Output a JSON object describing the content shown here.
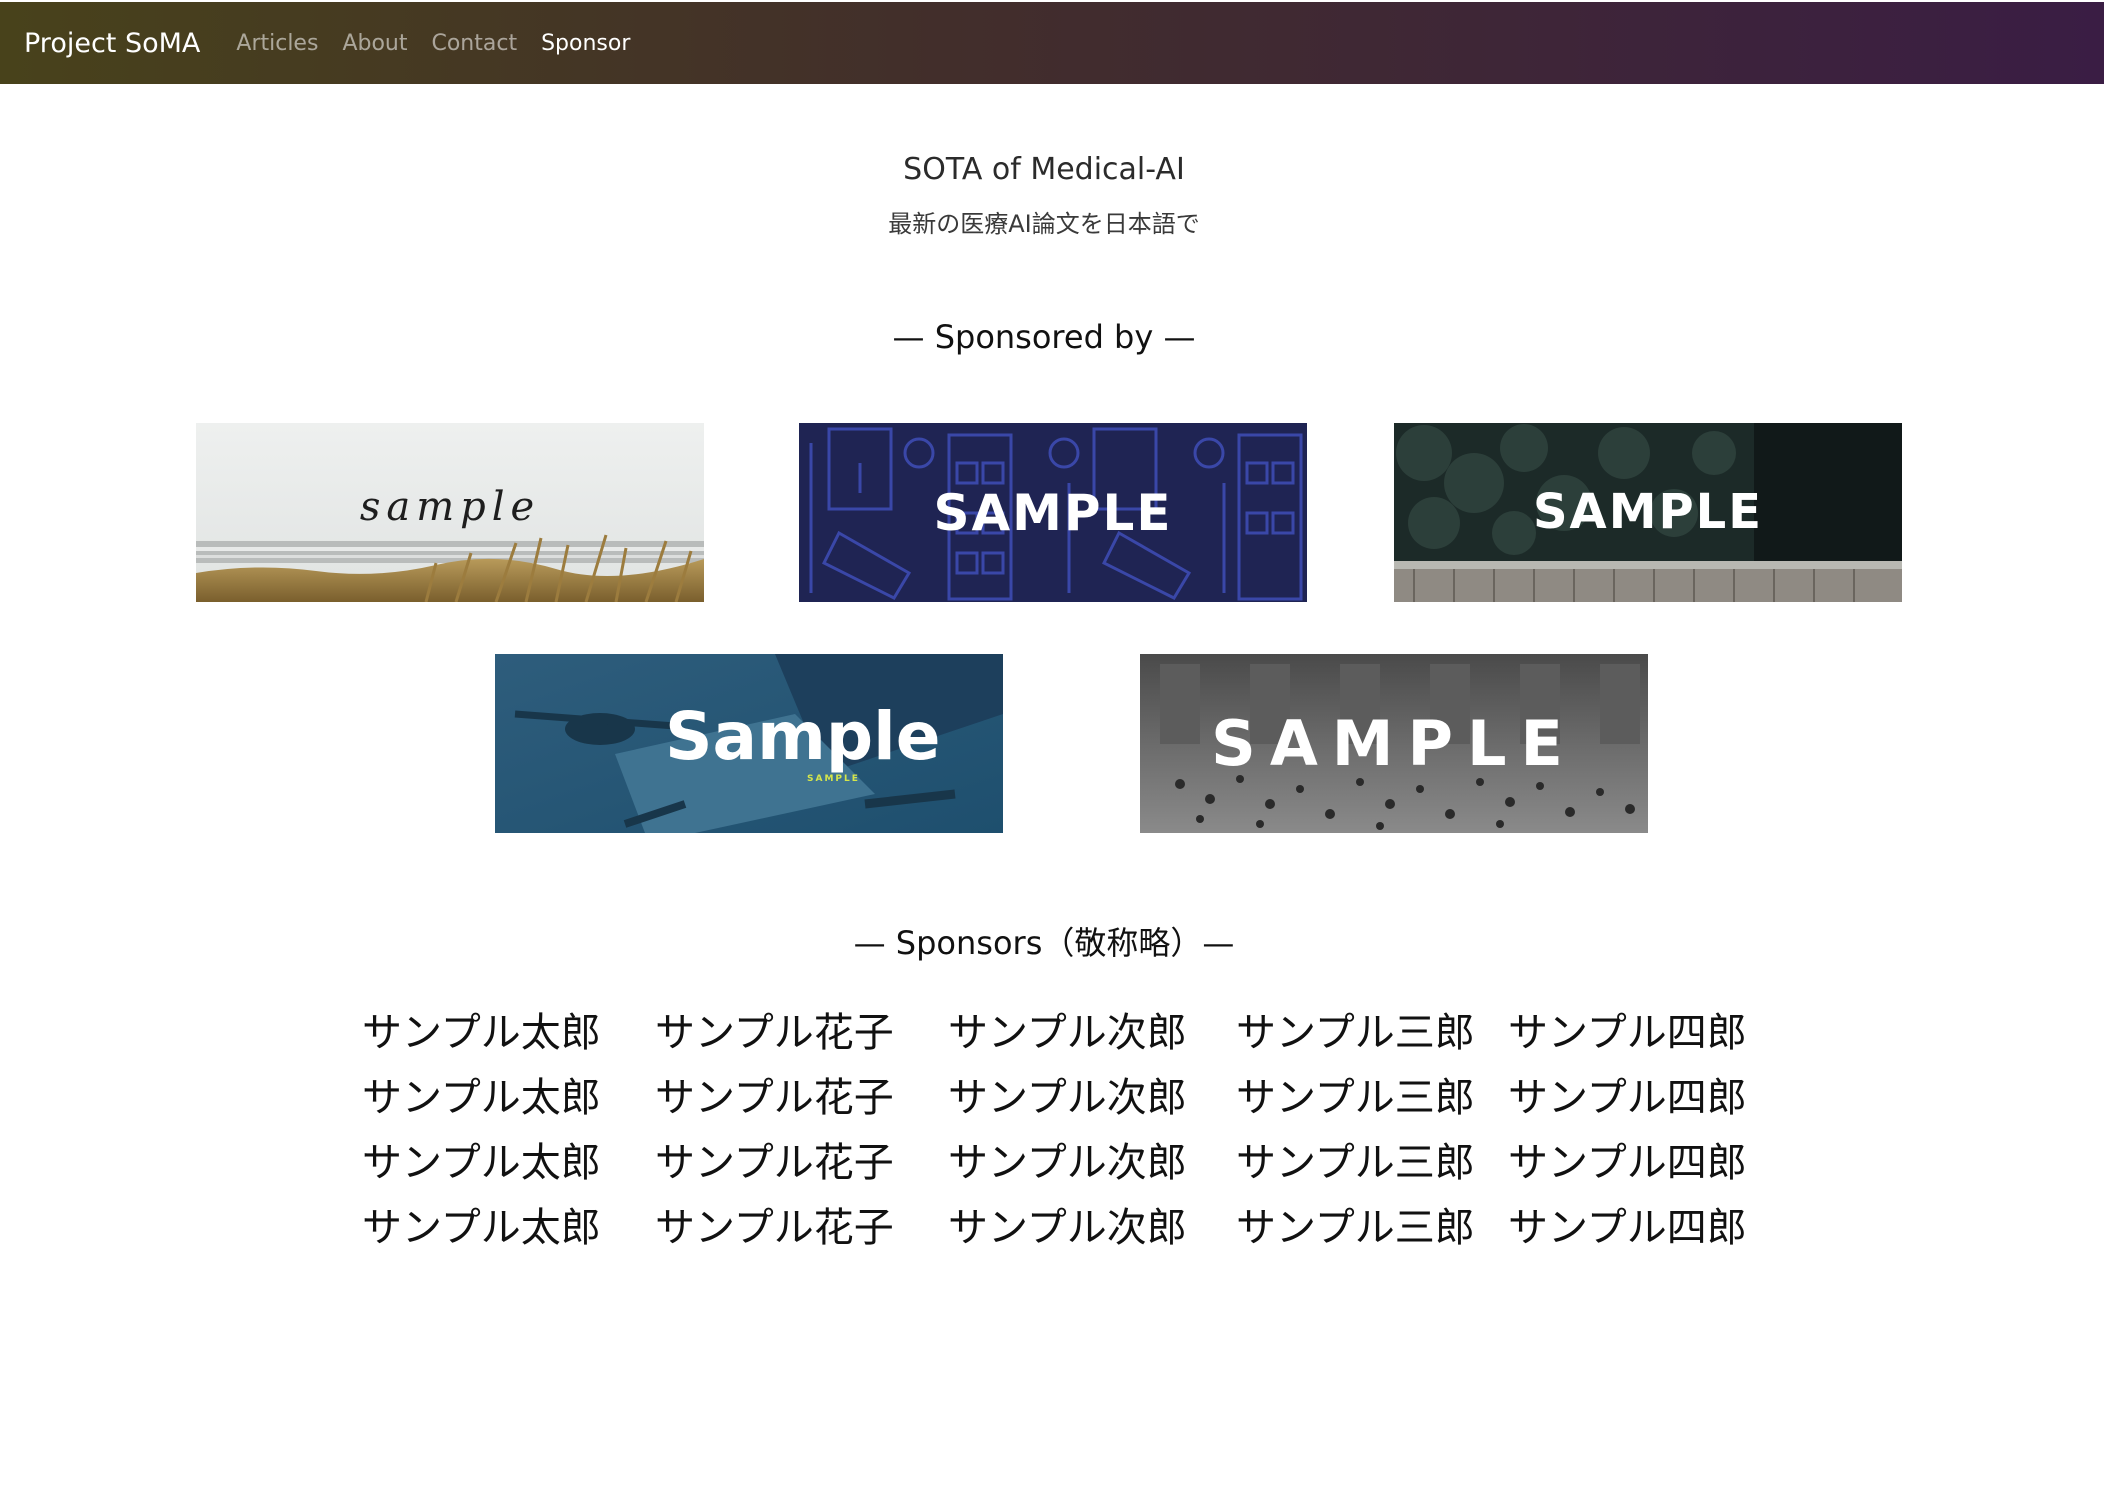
{
  "nav": {
    "brand": "Project SoMA",
    "links": [
      "Articles",
      "About",
      "Contact",
      "Sponsor"
    ],
    "active": "Sponsor"
  },
  "hero": {
    "title": "SOTA of Medical-AI",
    "subtitle": "最新の医療AI論文を日本語で"
  },
  "sponsored_by_heading": "— Sponsored by —",
  "banners": [
    {
      "label": "sample",
      "theme": "beach-grass"
    },
    {
      "label": "SAMPLE",
      "theme": "navy-line-icons"
    },
    {
      "label": "SAMPLE",
      "theme": "dark-forest-boardwalk"
    },
    {
      "label": "Sample",
      "sublabel": "SAMPLE",
      "theme": "blue-desk"
    },
    {
      "label": "SAMPLE",
      "theme": "grayscale-station-crowd"
    }
  ],
  "colors": {
    "navbar_start": "#48421b",
    "navbar_end": "#3a1d44",
    "banner2_bg": "#1f2453",
    "banner4_accent": "#d6e64a"
  },
  "sponsors_heading": "— Sponsors（敬称略）—",
  "sponsor_rows": [
    [
      "サンプル太郎",
      "サンプル花子",
      "サンプル次郎",
      "サンプル三郎",
      "サンプル四郎"
    ],
    [
      "サンプル太郎",
      "サンプル花子",
      "サンプル次郎",
      "サンプル三郎",
      "サンプル四郎"
    ],
    [
      "サンプル太郎",
      "サンプル花子",
      "サンプル次郎",
      "サンプル三郎",
      "サンプル四郎"
    ],
    [
      "サンプル太郎",
      "サンプル花子",
      "サンプル次郎",
      "サンプル三郎",
      "サンプル四郎"
    ]
  ]
}
